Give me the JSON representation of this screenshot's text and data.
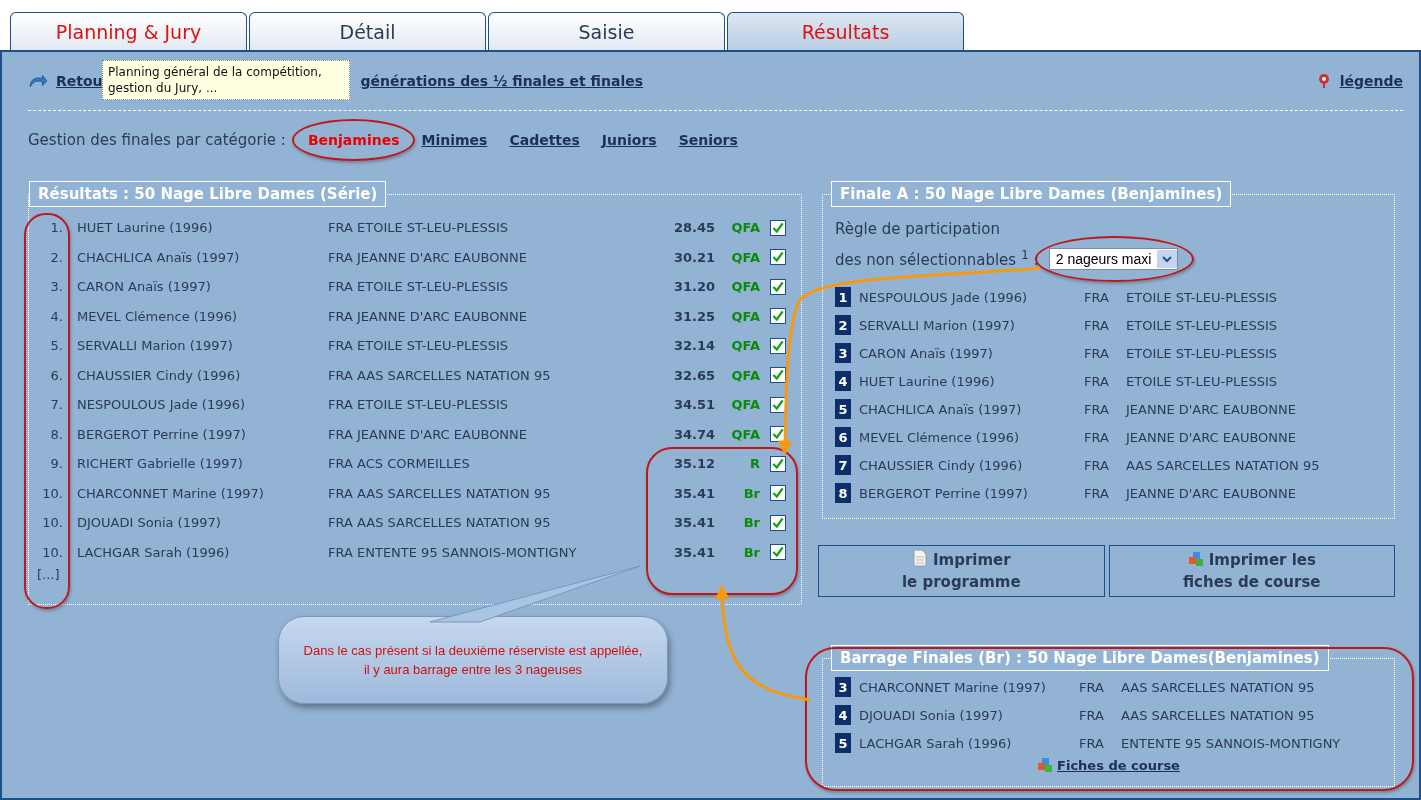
{
  "tabs": [
    {
      "label": "Planning & Jury",
      "selected": false,
      "highlighted": true
    },
    {
      "label": "Détail",
      "selected": false,
      "highlighted": false
    },
    {
      "label": "Saisie",
      "selected": false,
      "highlighted": false
    },
    {
      "label": "Résultats",
      "selected": true,
      "highlighted": true
    }
  ],
  "header": {
    "back_link": "Retou",
    "generation_link": "générations des ½ finales et finales",
    "legend_link": "légende"
  },
  "tooltip": "Planning général de la compétition, gestion du Jury, ...",
  "categories": {
    "label": "Gestion des finales par catégorie :",
    "items": [
      {
        "label": "Benjamines",
        "selected": true
      },
      {
        "label": "Minimes",
        "selected": false
      },
      {
        "label": "Cadettes",
        "selected": false
      },
      {
        "label": "Juniors",
        "selected": false
      },
      {
        "label": "Seniors",
        "selected": false
      }
    ]
  },
  "results": {
    "title": "Résultats : 50 Nage Libre Dames (Série)",
    "rows": [
      {
        "rank": "1.",
        "name": "HUET Laurine (1996)",
        "club": "FRA ETOILE ST-LEU-PLESSIS",
        "time": "28.45",
        "code": "QFA",
        "checked": true
      },
      {
        "rank": "2.",
        "name": "CHACHLICA Anaïs (1997)",
        "club": "FRA JEANNE D'ARC EAUBONNE",
        "time": "30.21",
        "code": "QFA",
        "checked": true
      },
      {
        "rank": "3.",
        "name": "CARON Anaïs (1997)",
        "club": "FRA ETOILE ST-LEU-PLESSIS",
        "time": "31.20",
        "code": "QFA",
        "checked": true
      },
      {
        "rank": "4.",
        "name": "MEVEL Clémence (1996)",
        "club": "FRA JEANNE D'ARC EAUBONNE",
        "time": "31.25",
        "code": "QFA",
        "checked": true
      },
      {
        "rank": "5.",
        "name": "SERVALLI Marion (1997)",
        "club": "FRA ETOILE ST-LEU-PLESSIS",
        "time": "32.14",
        "code": "QFA",
        "checked": true
      },
      {
        "rank": "6.",
        "name": "CHAUSSIER Cindy (1996)",
        "club": "FRA AAS SARCELLES NATATION 95",
        "time": "32.65",
        "code": "QFA",
        "checked": true
      },
      {
        "rank": "7.",
        "name": "NESPOULOUS Jade (1996)",
        "club": "FRA ETOILE ST-LEU-PLESSIS",
        "time": "34.51",
        "code": "QFA",
        "checked": true
      },
      {
        "rank": "8.",
        "name": "BERGEROT Perrine (1997)",
        "club": "FRA JEANNE D'ARC EAUBONNE",
        "time": "34.74",
        "code": "QFA",
        "checked": true
      },
      {
        "rank": "9.",
        "name": "RICHERT Gabrielle (1997)",
        "club": "FRA ACS CORMEILLES",
        "time": "35.12",
        "code": "R",
        "checked": true
      },
      {
        "rank": "10.",
        "name": "CHARCONNET Marine (1997)",
        "club": "FRA AAS SARCELLES NATATION 95",
        "time": "35.41",
        "code": "Br",
        "checked": true
      },
      {
        "rank": "10.",
        "name": "DJOUADI Sonia (1997)",
        "club": "FRA AAS SARCELLES NATATION 95",
        "time": "35.41",
        "code": "Br",
        "checked": true
      },
      {
        "rank": "10.",
        "name": "LACHGAR Sarah (1996)",
        "club": "FRA ENTENTE 95 SANNOIS-MONTIGNY",
        "time": "35.41",
        "code": "Br",
        "checked": true
      }
    ],
    "more": "[...]"
  },
  "finale": {
    "title": "Finale A : 50 Nage Libre Dames (Benjamines)",
    "rule_label": "Règle de participation\ndes non sélectionnables $^{1}$ :",
    "rule_value": "2 nageurs maxi",
    "rows": [
      {
        "number": "1",
        "name": "NESPOULOUS Jade (1996)",
        "country": "FRA",
        "club": "ETOILE ST-LEU-PLESSIS"
      },
      {
        "number": "2",
        "name": "SERVALLI Marion (1997)",
        "country": "FRA",
        "club": "ETOILE ST-LEU-PLESSIS"
      },
      {
        "number": "3",
        "name": "CARON Anaïs (1997)",
        "country": "FRA",
        "club": "ETOILE ST-LEU-PLESSIS"
      },
      {
        "number": "4",
        "name": "HUET Laurine (1996)",
        "country": "FRA",
        "club": "ETOILE ST-LEU-PLESSIS"
      },
      {
        "number": "5",
        "name": "CHACHLICA Anaïs (1997)",
        "country": "FRA",
        "club": "JEANNE D'ARC EAUBONNE"
      },
      {
        "number": "6",
        "name": "MEVEL Clémence (1996)",
        "country": "FRA",
        "club": "JEANNE D'ARC EAUBONNE"
      },
      {
        "number": "7",
        "name": "CHAUSSIER Cindy (1996)",
        "country": "FRA",
        "club": "AAS SARCELLES NATATION 95"
      },
      {
        "number": "8",
        "name": "BERGEROT Perrine (1997)",
        "country": "FRA",
        "club": "JEANNE D'ARC EAUBONNE"
      }
    ]
  },
  "buttons": [
    {
      "kind": "document",
      "label": "Imprimer\nle programme"
    },
    {
      "kind": "cubes",
      "label": "Imprimer les\nfiches de course"
    }
  ],
  "callout": "Dans le cas présent si la deuxième réserviste est appellée, il y aura barrage entre les 3 nageuses",
  "barrage": {
    "title": "Barrage Finales (Br) : 50 Nage Libre Dames(Benjamines)",
    "rows": [
      {
        "number": "3",
        "name": "CHARCONNET Marine (1997)",
        "country": "FRA",
        "club": "AAS SARCELLES NATATION 95"
      },
      {
        "number": "4",
        "name": "DJOUADI Sonia (1997)",
        "country": "FRA",
        "club": "AAS SARCELLES NATATION 95"
      },
      {
        "number": "5",
        "name": "LACHGAR Sarah (1996)",
        "country": "FRA",
        "club": "ENTENTE 95 SANNOIS-MONTIGNY"
      }
    ],
    "link": "Fiches de course"
  }
}
